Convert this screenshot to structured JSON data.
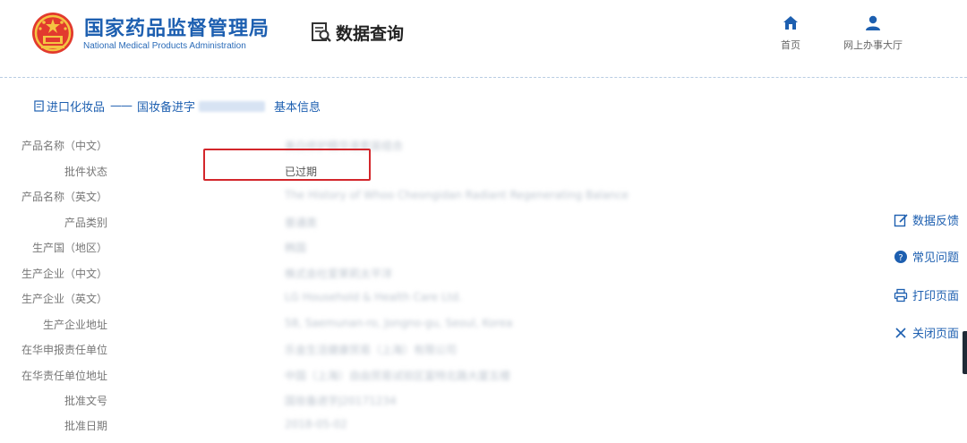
{
  "header": {
    "agency_cn": "国家药品监督管理局",
    "agency_en": "National Medical Products Administration",
    "query_label": "数据查询",
    "nav": [
      {
        "label": "首页",
        "icon": "home-icon"
      },
      {
        "label": "网上办事大厅",
        "icon": "user-icon"
      }
    ]
  },
  "breadcrumb": {
    "category": "进口化妆品",
    "separator": "——",
    "record_prefix": "国妆备进字",
    "section": "基本信息"
  },
  "fields": [
    {
      "label": "产品名称（中文）",
      "value": "美白修护精华液套装组合",
      "blurred": true
    },
    {
      "label": "批件状态",
      "value": "已过期",
      "blurred": false
    },
    {
      "label": "产品名称（英文）",
      "value": "The History of Whoo Cheongidan Radiant Regenerating Balance",
      "blurred": true
    },
    {
      "label": "产品类别",
      "value": "普通类",
      "blurred": true
    },
    {
      "label": "生产国（地区）",
      "value": "韩国",
      "blurred": true
    },
    {
      "label": "生产企业（中文）",
      "value": "株式会社爱茉莉太平洋",
      "blurred": true
    },
    {
      "label": "生产企业（英文）",
      "value": "LG Household & Health Care Ltd.",
      "blurred": true
    },
    {
      "label": "生产企业地址",
      "value": "58, Saemunan-ro, Jongno-gu, Seoul, Korea",
      "blurred": true
    },
    {
      "label": "在华申报责任单位",
      "value": "乐金生活健康贸易（上海）有限公司",
      "blurred": true
    },
    {
      "label": "在华责任单位地址",
      "value": "中国（上海）自由贸易试验区富特北路大厦五楼",
      "blurred": true
    },
    {
      "label": "批准文号",
      "value": "国妆备进字J20171234",
      "blurred": true
    },
    {
      "label": "批准日期",
      "value": "2018-05-02",
      "blurred": true
    }
  ],
  "sidebar": [
    {
      "label": "数据反馈",
      "icon": "edit-icon"
    },
    {
      "label": "常见问题",
      "icon": "question-icon"
    },
    {
      "label": "打印页面",
      "icon": "print-icon"
    },
    {
      "label": "关闭页面",
      "icon": "close-icon"
    }
  ],
  "colors": {
    "brand": "#1d5fb0",
    "highlight": "#d3262b"
  }
}
